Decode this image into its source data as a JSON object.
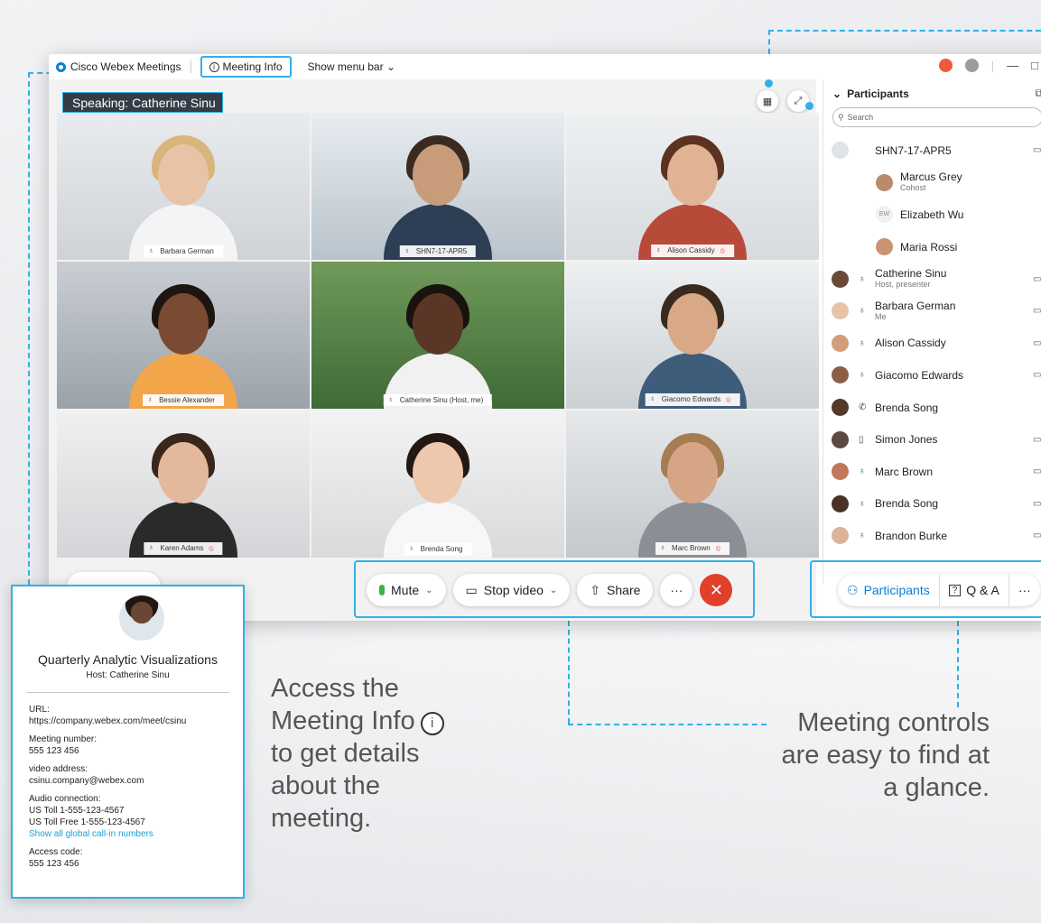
{
  "window": {
    "app_name": "Cisco Webex Meetings",
    "meeting_info_label": "Meeting Info",
    "show_menu_bar_label": "Show menu bar",
    "minimize": "—",
    "maximize": "□"
  },
  "stage": {
    "speaking_label": "Speaking: Catherine Sinu",
    "tiles": [
      {
        "name": "Barbara German",
        "muted": false
      },
      {
        "name": "SHN7-17-APR5",
        "muted": false
      },
      {
        "name": "Alison Cassidy",
        "muted": true
      },
      {
        "name": "Bessie Alexander",
        "muted": false
      },
      {
        "name": "Catherine Sinu (Host, me)",
        "muted": false,
        "active": true
      },
      {
        "name": "Giacomo Edwards",
        "muted": true
      },
      {
        "name": "Karen Adams",
        "muted": true
      },
      {
        "name": "Brenda Song",
        "muted": false
      },
      {
        "name": "Marc Brown",
        "muted": true
      }
    ]
  },
  "participants_panel": {
    "title": "Participants",
    "search_placeholder": "Search",
    "rows": [
      {
        "name": "SHN7-17-APR5",
        "sub": "",
        "icon": "room-icon"
      },
      {
        "name": "Marcus Grey",
        "sub": "Cohost",
        "indent": true
      },
      {
        "name": "Elizabeth Wu",
        "sub": "",
        "indent": true,
        "initials": "EW"
      },
      {
        "name": "Maria Rossi",
        "sub": "",
        "indent": true
      },
      {
        "name": "Catherine Sinu",
        "sub": "Host, presenter"
      },
      {
        "name": "Barbara German",
        "sub": "Me"
      },
      {
        "name": "Alison Cassidy",
        "sub": ""
      },
      {
        "name": "Giacomo Edwards",
        "sub": ""
      },
      {
        "name": "Brenda Song",
        "sub": "",
        "icon": "phone-icon"
      },
      {
        "name": "Simon Jones",
        "sub": "",
        "icon": "device-icon"
      },
      {
        "name": "Marc Brown",
        "sub": ""
      },
      {
        "name": "Brenda Song",
        "sub": ""
      },
      {
        "name": "Brandon Burke",
        "sub": ""
      }
    ]
  },
  "controls": {
    "mute_label": "Mute",
    "stop_video_label": "Stop video",
    "share_label": "Share",
    "more_label": "···",
    "end_label": "✕"
  },
  "right_controls": {
    "participants_label": "Participants",
    "qa_label": "Q & A",
    "more_label": "···"
  },
  "meeting_card": {
    "title": "Quarterly Analytic Visualizations",
    "host": "Host: Catherine Sinu",
    "fields": [
      {
        "label": "URL:",
        "value": "https://company.webex.com/meet/csinu"
      },
      {
        "label": "Meeting number:",
        "value": "555 123 456"
      },
      {
        "label": "video address:",
        "value": "csinu.company@webex.com"
      },
      {
        "label": "Audio connection:",
        "value": "US Toll 1-555-123-4567",
        "value2": "US Toll Free 1-555-123-4567",
        "link": "Show all global call-in numbers"
      },
      {
        "label": "Access code:",
        "value": "555 123 456"
      }
    ]
  },
  "captions": {
    "left_line1": "Access the",
    "left_bold": "Meeting Info",
    "left_line3": "to get details",
    "left_line4": "about the",
    "left_line5": "meeting.",
    "right_line1": "Meeting controls",
    "right_line2": "are easy to find at",
    "right_line3": "a glance."
  },
  "colors": {
    "accent": "#2fb1e8",
    "end_call": "#e1402b",
    "mic_green": "#3bb54a",
    "muted_red": "#e23b2e",
    "link_blue": "#0a7fd1"
  }
}
